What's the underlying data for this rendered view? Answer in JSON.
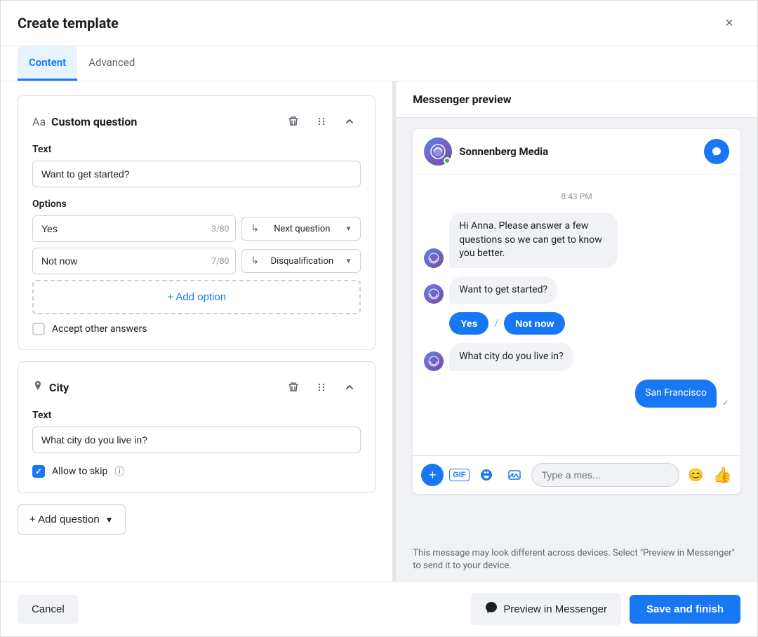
{
  "modal": {
    "title": "Create template",
    "close_label": "×"
  },
  "tabs": {
    "content_label": "Content",
    "advanced_label": "Advanced"
  },
  "custom_question": {
    "card_title": "Custom question",
    "text_label": "Text",
    "text_value": "Want to get started?",
    "options_label": "Options",
    "options": [
      {
        "value": "Yes",
        "count": "3/80",
        "action": "Next question"
      },
      {
        "value": "Not now",
        "count": "7/80",
        "action": "Disqualification"
      }
    ],
    "add_option_label": "+ Add option",
    "accept_other_label": "Accept other answers",
    "accept_other_checked": false
  },
  "city_question": {
    "card_title": "City",
    "text_label": "Text",
    "text_value": "What city do you live in?",
    "allow_skip_label": "Allow to skip",
    "allow_skip_checked": true
  },
  "add_question_label": "+ Add question",
  "preview": {
    "title": "Messenger preview",
    "brand_name": "Sonnenberg Media",
    "timestamp": "8:43 PM",
    "messages": [
      {
        "type": "bot",
        "text": "Hi Anna. Please answer a few questions so we can get to know you better."
      },
      {
        "type": "bot",
        "text": "Want to get started?"
      },
      {
        "type": "quick_replies",
        "replies": [
          "Yes",
          "Not now"
        ]
      },
      {
        "type": "bot",
        "text": "What city do you live in?"
      },
      {
        "type": "user",
        "text": "San Francisco"
      }
    ],
    "input_placeholder": "Type a mes...",
    "disclaimer": "This message may look different across devices. Select \"Preview in Messenger\" to send it to your device."
  },
  "footer": {
    "cancel_label": "Cancel",
    "preview_label": "Preview in Messenger",
    "save_label": "Save and finish"
  }
}
